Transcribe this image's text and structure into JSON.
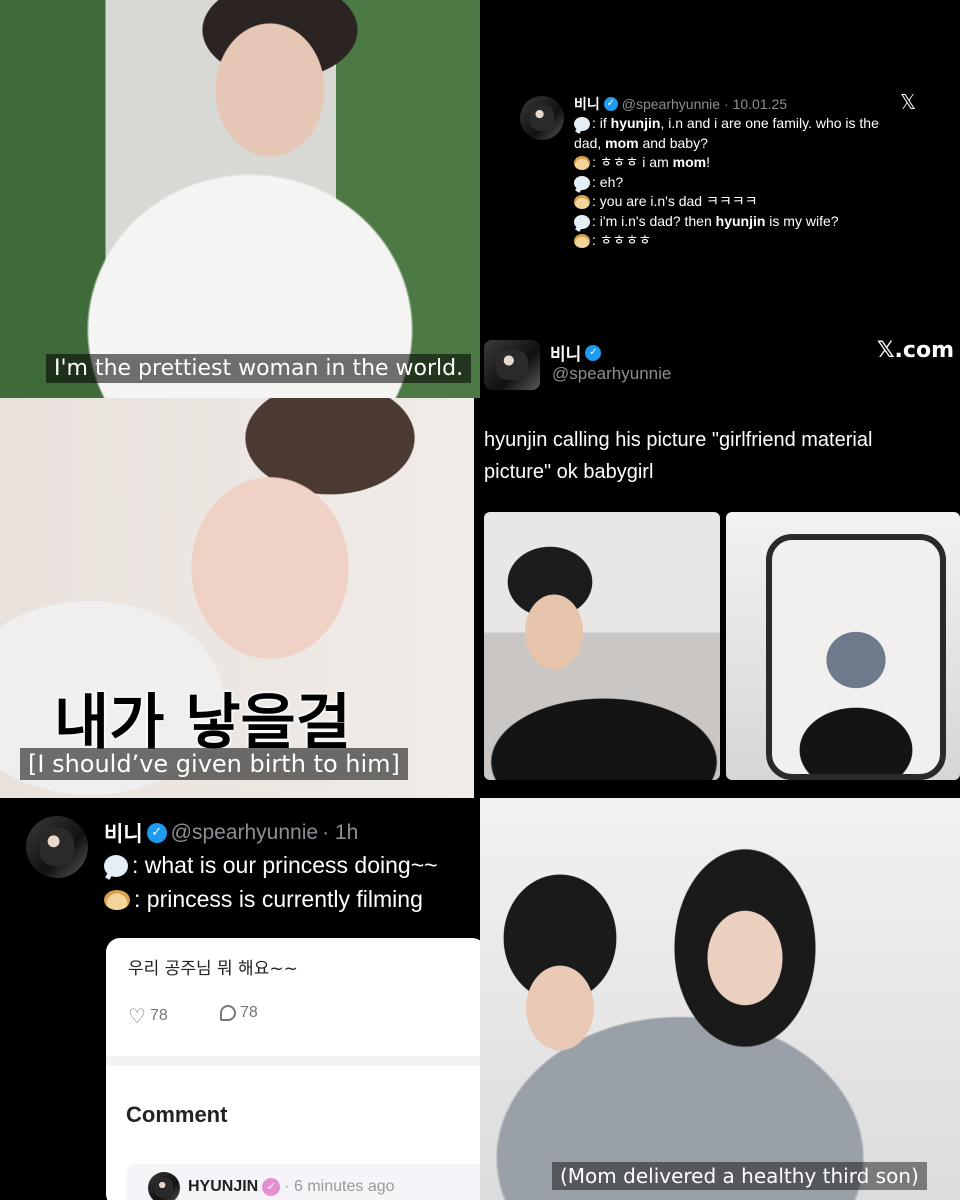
{
  "panel1": {
    "subtitle": "I'm the prettiest woman in the world."
  },
  "tweet1": {
    "name": "비니",
    "handle": "@spearhyunnie",
    "date": "· 10.01.25",
    "x_logo": "𝕏",
    "lines": [
      {
        "icon": "speech-bubble",
        "parts": [
          ": if ",
          "hyunjin",
          ", i.n and i are one family. who is the"
        ]
      },
      {
        "icon": "",
        "parts": [
          "dad, ",
          "mom",
          " and baby?"
        ]
      },
      {
        "icon": "dumpling",
        "parts": [
          ": ㅎㅎㅎ i am ",
          "mom",
          "!"
        ]
      },
      {
        "icon": "speech-bubble",
        "parts": [
          ": eh?"
        ]
      },
      {
        "icon": "dumpling",
        "parts": [
          ": you are i.n's dad ㅋㅋㅋㅋ"
        ]
      },
      {
        "icon": "speech-bubble",
        "parts": [
          ": i'm i.n's dad? then ",
          "hyunjin",
          " is my wife?"
        ]
      },
      {
        "icon": "dumpling",
        "parts": [
          ": ㅎㅎㅎㅎ"
        ]
      }
    ]
  },
  "tweet2": {
    "name": "비니",
    "handle": "@spearhyunnie",
    "brand": "𝕏.com",
    "text_line1": "hyunjin calling his picture \"girlfriend material",
    "text_line2": "picture\" ok babygirl"
  },
  "panel3": {
    "korean_caption": "내가 낳을걸",
    "subtitle": "[I should’ve given birth to him]"
  },
  "tweet3": {
    "name": "비니",
    "handle": "@spearhyunnie",
    "time": "· 1h",
    "line1": ": what is our princess doing~~",
    "line2": ": princess is currently filming",
    "post_text": "우리 공주님 뭐 해요~~",
    "likes": "78",
    "comments": "78",
    "comment_heading": "Comment",
    "commenter": "HYUNJIN",
    "comment_time": "· 6 minutes ago"
  },
  "panel6": {
    "subtitle": "(Mom delivered a healthy third son)"
  },
  "colors": {
    "verified": "#1d9bf0",
    "commenter_badge": "#e58fcf"
  }
}
